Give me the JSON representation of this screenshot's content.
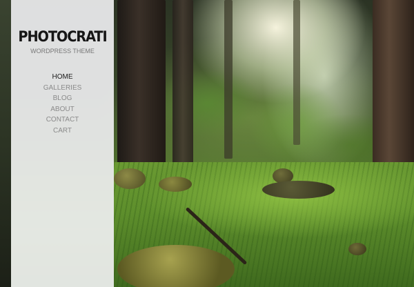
{
  "site": {
    "title": "PHOTOCRATI",
    "tagline": "WORDPRESS THEME"
  },
  "nav": {
    "items": [
      {
        "label": "HOME",
        "active": true
      },
      {
        "label": "GALLERIES",
        "active": false
      },
      {
        "label": "BLOG",
        "active": false
      },
      {
        "label": "ABOUT",
        "active": false
      },
      {
        "label": "CONTACT",
        "active": false
      },
      {
        "label": "CART",
        "active": false
      }
    ]
  },
  "colors": {
    "sidebar_bg": "#eeeef0",
    "active_link": "#1a1a1a",
    "inactive_link": "#8a8a8a"
  },
  "background": {
    "image": "forest-clearing-photo"
  }
}
